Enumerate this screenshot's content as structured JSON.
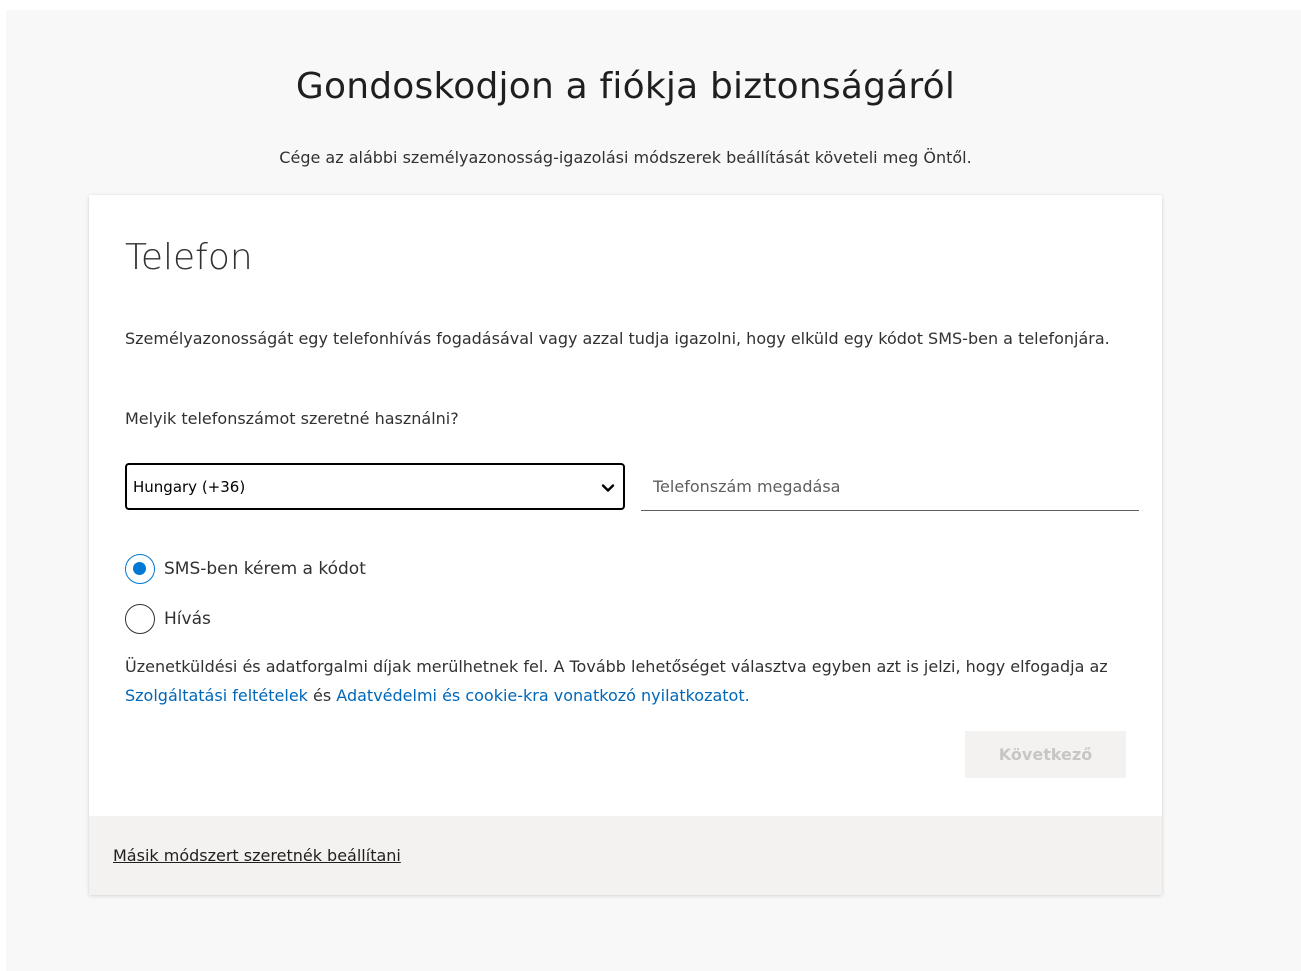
{
  "header": {
    "title": "Gondoskodjon a fiókja biztonságáról",
    "subtitle": "Cége az alábbi személyazonosság-igazolási módszerek beállítását követeli meg Öntől."
  },
  "card": {
    "section_title": "Telefon",
    "description": "Személyazonosságát egy telefonhívás fogadásával vagy azzal tudja igazolni, hogy elküld egy kódot SMS-ben a telefonjára.",
    "question": "Melyik telefonszámot szeretné használni?",
    "country_select": {
      "selected": "Hungary (+36)"
    },
    "phone_input": {
      "value": "",
      "placeholder": "Telefonszám megadása"
    },
    "methods": [
      {
        "label": "SMS-ben kérem a kódot",
        "checked": true
      },
      {
        "label": "Hívás",
        "checked": false
      }
    ],
    "disclaimer": {
      "text_before": "Üzenetküldési és adatforgalmi díjak merülhetnek fel. A Tovább lehetőséget választva egyben azt is jelzi, hogy elfogadja az ",
      "terms_link": "Szolgáltatási feltételek",
      "and_text": " és ",
      "privacy_link": "Adatvédelmi és cookie-kra vonatkozó nyilatkozatot."
    },
    "next_button": "Következő",
    "other_method_link": "Másik módszert szeretnék beállítani"
  },
  "colors": {
    "accent": "#0078d4",
    "link": "#0067b8",
    "disabled_text": "#c8c6c4",
    "disabled_bg": "#f3f2f1"
  },
  "icons": {
    "select_arrow": "chevron-down-icon"
  }
}
